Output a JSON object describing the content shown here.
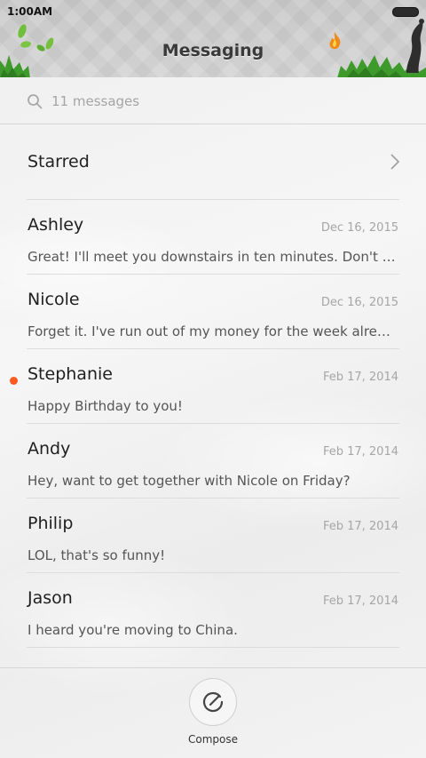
{
  "status_bar": {
    "time": "1:00AM"
  },
  "header": {
    "title": "Messaging"
  },
  "search": {
    "placeholder": "11 messages"
  },
  "starred": {
    "label": "Starred"
  },
  "messages": [
    {
      "name": "Ashley",
      "date": "Dec 16, 2015",
      "preview": "Great! I'll meet you downstairs in ten minutes. Don't forget your...",
      "unread": false
    },
    {
      "name": "Nicole",
      "date": "Dec 16, 2015",
      "preview": "Forget it. I've run out of my money for the week already.",
      "unread": false
    },
    {
      "name": "Stephanie",
      "date": "Feb 17, 2014",
      "preview": "Happy Birthday to you!",
      "unread": true
    },
    {
      "name": "Andy",
      "date": "Feb 17, 2014",
      "preview": "Hey, want to get together with Nicole on Friday?",
      "unread": false
    },
    {
      "name": "Philip",
      "date": "Feb 17, 2014",
      "preview": "LOL, that's so funny!",
      "unread": false
    },
    {
      "name": "Jason",
      "date": "Feb 17, 2014",
      "preview": "I heard you're moving to China.",
      "unread": false
    }
  ],
  "footer": {
    "compose_label": "Compose"
  },
  "colors": {
    "unread_dot": "#ff5a1f",
    "grass": "#3f9a2c",
    "leaf": "#6fbf3a"
  },
  "icons": {
    "search": "search-icon",
    "chevron": "chevron-right-icon",
    "compose": "compose-icon"
  }
}
